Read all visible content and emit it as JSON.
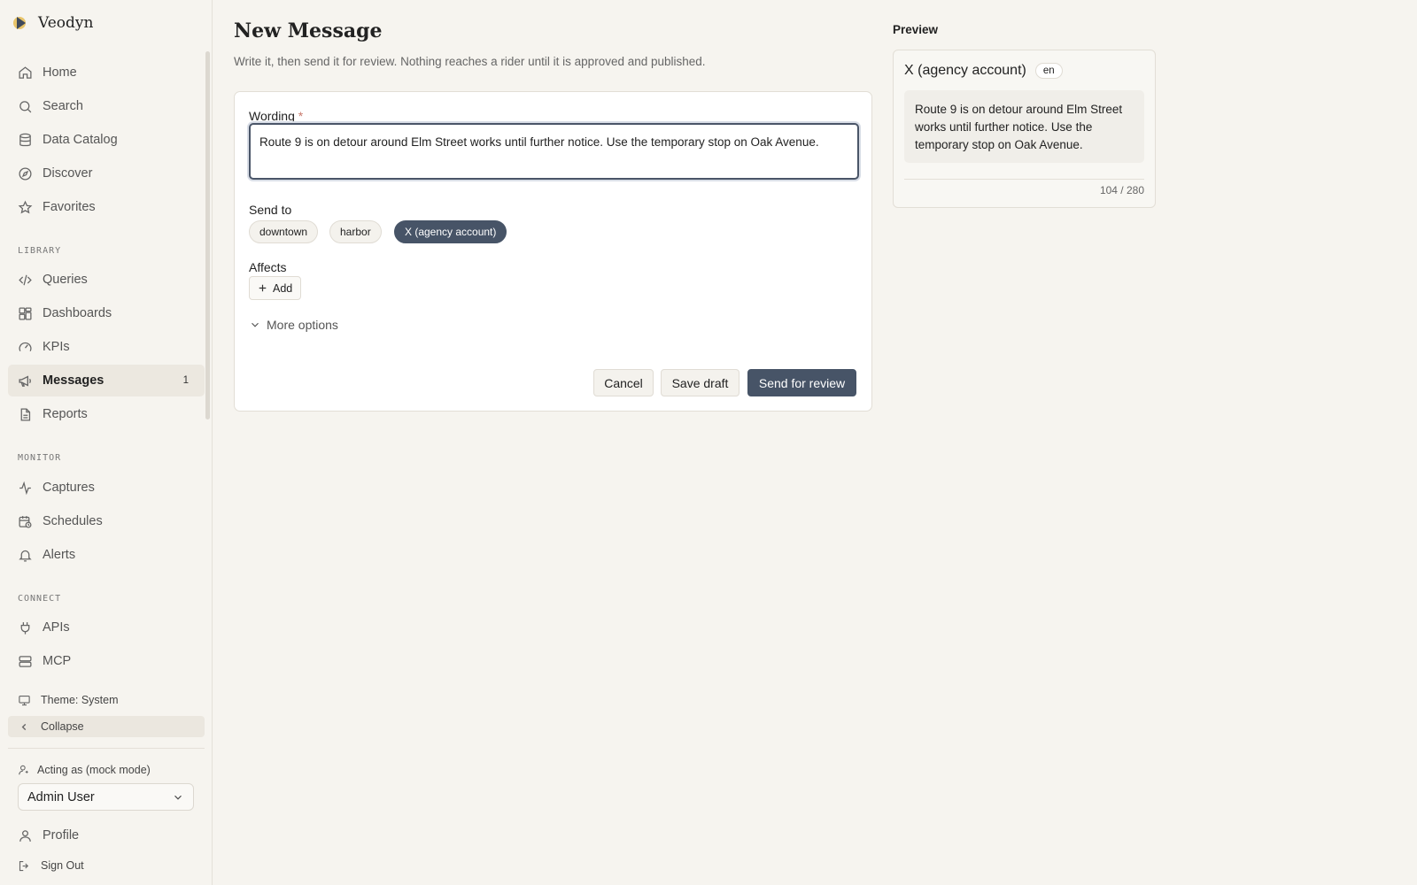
{
  "brand": {
    "name": "Veodyn"
  },
  "sidebar": {
    "primary": [
      {
        "label": "Home",
        "icon": "home-icon"
      },
      {
        "label": "Search",
        "icon": "search-icon"
      },
      {
        "label": "Data Catalog",
        "icon": "database-icon"
      },
      {
        "label": "Discover",
        "icon": "compass-icon"
      },
      {
        "label": "Favorites",
        "icon": "star-icon"
      }
    ],
    "sections": {
      "library": "LIBRARY",
      "monitor": "MONITOR",
      "connect": "CONNECT"
    },
    "library": [
      {
        "label": "Queries",
        "icon": "code-icon"
      },
      {
        "label": "Dashboards",
        "icon": "dashboard-icon"
      },
      {
        "label": "KPIs",
        "icon": "gauge-icon"
      },
      {
        "label": "Messages",
        "icon": "megaphone-icon",
        "badge": "1",
        "active": true
      },
      {
        "label": "Reports",
        "icon": "document-icon"
      }
    ],
    "monitor": [
      {
        "label": "Captures",
        "icon": "activity-icon"
      },
      {
        "label": "Schedules",
        "icon": "calendar-clock-icon"
      },
      {
        "label": "Alerts",
        "icon": "bell-icon"
      }
    ],
    "connect": [
      {
        "label": "APIs",
        "icon": "plug-icon"
      },
      {
        "label": "MCP",
        "icon": "server-icon"
      }
    ],
    "theme_label": "Theme: System",
    "collapse_label": "Collapse",
    "acting_label": "Acting as (mock mode)",
    "acting_user": "Admin User",
    "profile_label": "Profile",
    "signout_label": "Sign Out"
  },
  "page": {
    "title": "New Message",
    "subtitle": "Write it, then send it for review. Nothing reaches a rider until it is approved and published."
  },
  "form": {
    "wording_label": "Wording",
    "required_mark": "*",
    "wording_value": "Route 9 is on detour around Elm Street works until further notice. Use the temporary stop on Oak Avenue.",
    "send_to_label": "Send to",
    "channels": [
      {
        "label": "downtown",
        "selected": false
      },
      {
        "label": "harbor",
        "selected": false
      },
      {
        "label": "X (agency account)",
        "selected": true
      }
    ],
    "affects_label": "Affects",
    "add_label": "Add",
    "more_options_label": "More options",
    "cancel_label": "Cancel",
    "save_draft_label": "Save draft",
    "send_review_label": "Send for review"
  },
  "preview": {
    "title": "Preview",
    "channel": "X (agency account)",
    "lang": "en",
    "body": "Route 9 is on detour around Elm Street works until further notice. Use the temporary stop on Oak Avenue.",
    "count": "104 / 280"
  },
  "colors": {
    "accent": "#475467",
    "background": "#f6f4ef",
    "required": "#c97a6d"
  }
}
